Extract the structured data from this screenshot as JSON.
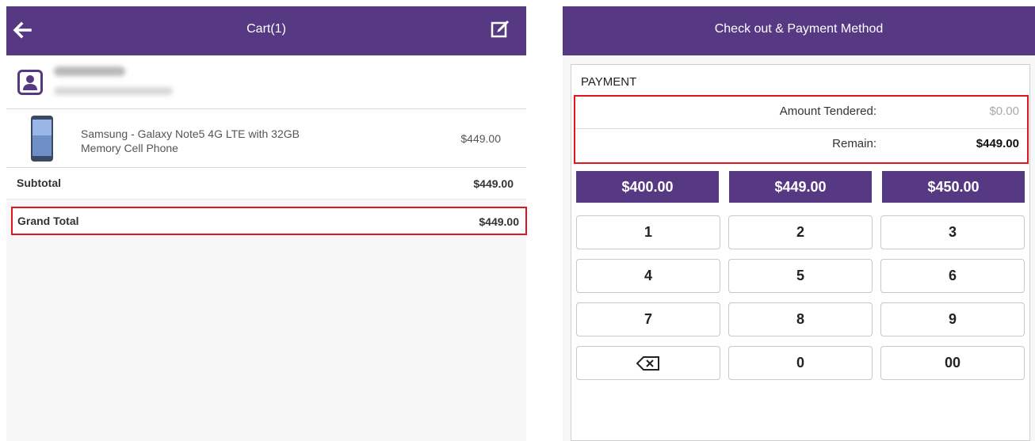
{
  "cart": {
    "title": "Cart(1)",
    "item": {
      "name": "Samsung - Galaxy Note5 4G LTE with 32GB Memory Cell Phone",
      "price": "$449.00"
    },
    "subtotal_label": "Subtotal",
    "subtotal_value": "$449.00",
    "grand_total_label": "Grand Total",
    "grand_total_value": "$449.00"
  },
  "payment": {
    "title": "Check out & Payment Method",
    "section_label": "PAYMENT",
    "amount_tendered_label": "Amount Tendered:",
    "amount_tendered_value": "$0.00",
    "remain_label": "Remain:",
    "remain_value": "$449.00",
    "quick_amounts": [
      "$400.00",
      "$449.00",
      "$450.00"
    ],
    "keys": [
      "1",
      "2",
      "3",
      "4",
      "5",
      "6",
      "7",
      "8",
      "9",
      "0",
      "00"
    ]
  },
  "colors": {
    "brand": "#573983",
    "highlight": "#e0161b"
  }
}
